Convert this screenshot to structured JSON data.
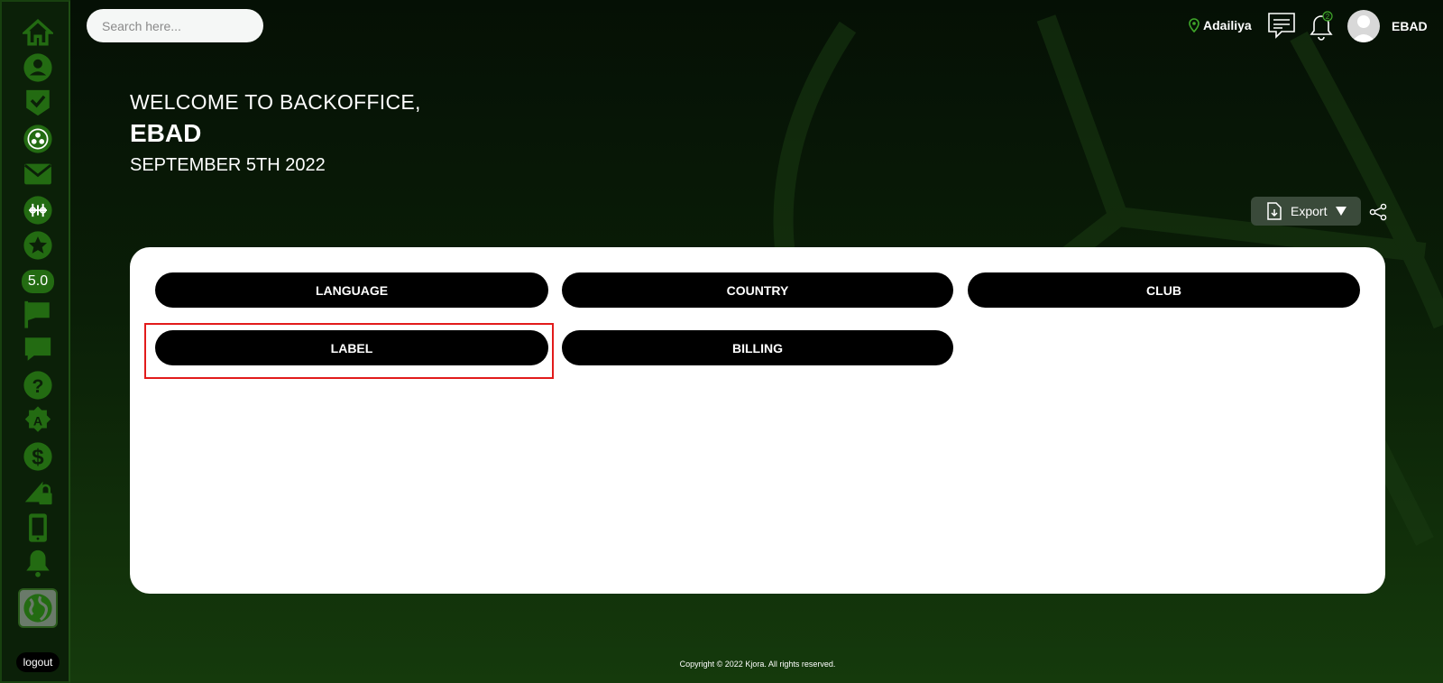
{
  "search": {
    "placeholder": "Search here..."
  },
  "header": {
    "location": "Adailiya",
    "notification_count": "2",
    "username": "EBAD"
  },
  "welcome": {
    "line1": "WELCOME TO BACKOFFICE,",
    "name": "EBAD",
    "date": "SEPTEMBER 5TH 2022"
  },
  "toolbar": {
    "export_label": "Export"
  },
  "sidebar": {
    "items": [
      "home-icon",
      "user-icon",
      "check-shield-icon",
      "football-icon",
      "mail-icon",
      "table-football-icon",
      "star-icon",
      "flag-icon",
      "chat-icon",
      "help-icon",
      "badge-a-icon",
      "dollar-icon",
      "lock-icon",
      "mobile-icon",
      "bell-icon",
      "globe-icon"
    ],
    "version": "5.0",
    "logout": "logout"
  },
  "settings_buttons": [
    "LANGUAGE",
    "COUNTRY",
    "CLUB",
    "LABEL",
    "BILLING"
  ],
  "footer": {
    "copyright": "Copyright © 2022 Kjora. All rights reserved."
  },
  "colors": {
    "sidebar_icon": "#236b12",
    "highlight": "#e21b1b"
  }
}
